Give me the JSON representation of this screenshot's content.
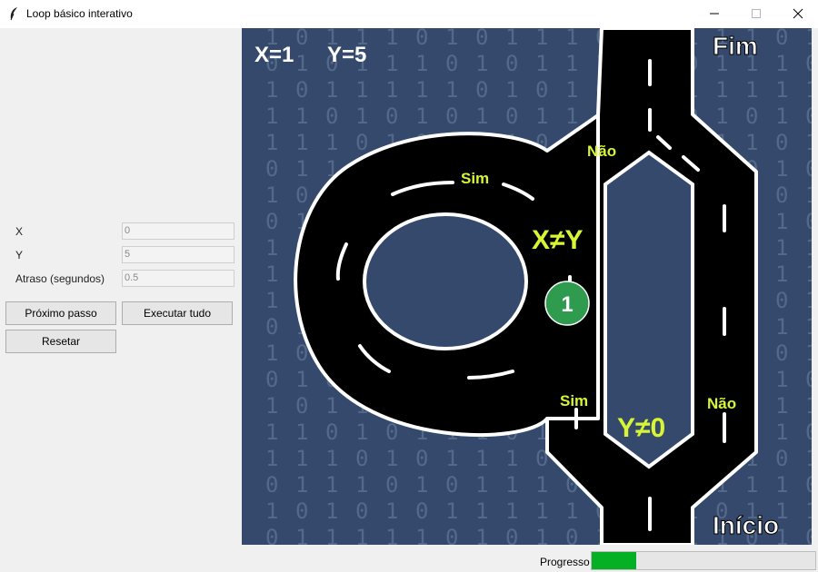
{
  "window": {
    "title": "Loop básico interativo",
    "icon": "feather-icon"
  },
  "controls": {
    "fields": [
      {
        "label": "X",
        "value": "0"
      },
      {
        "label": "Y",
        "value": "5"
      },
      {
        "label": "Atraso (segundos)",
        "value": "0.5"
      }
    ],
    "next_step_label": "Próximo passo",
    "run_all_label": "Executar tudo",
    "reset_label": "Resetar"
  },
  "scene": {
    "x_readout": "X=1",
    "y_readout": "Y=5",
    "end_label": "Fim",
    "start_label": "Início",
    "cond_xy": "X≠Y",
    "cond_y0": "Y≠0",
    "branch_sim_1": "Sim",
    "branch_nao_1": "Não",
    "branch_sim_2": "Sim",
    "branch_nao_2": "Não",
    "marker_value": "1",
    "background_color": "#34496b",
    "road_color": "#000000",
    "label_color": "#d7f535",
    "marker_color": "#2e9b4e"
  },
  "status": {
    "progress_label": "Progresso",
    "progress_fraction": 0.2
  }
}
